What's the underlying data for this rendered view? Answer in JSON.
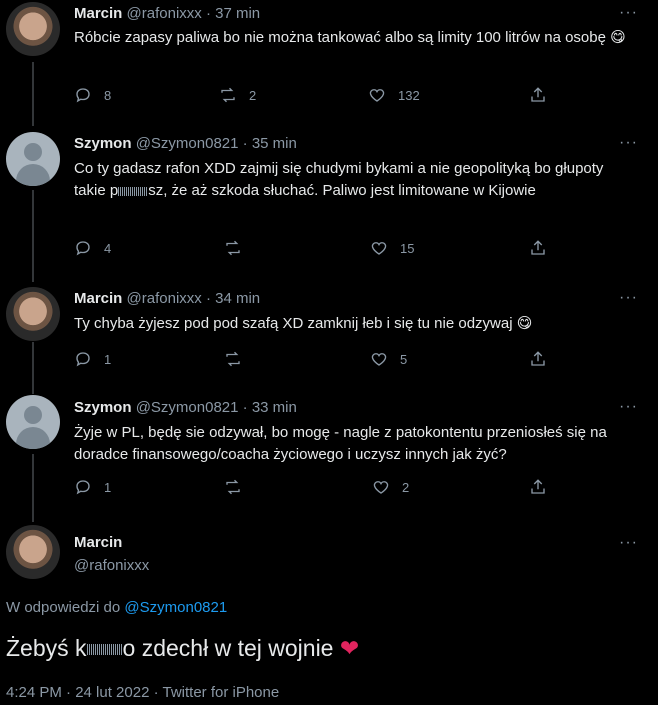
{
  "tweets": [
    {
      "name": "Marcin",
      "handle": "@rafonixxx",
      "dot": "·",
      "time": "37 min",
      "text": "Róbcie zapasy paliwa bo nie można tankować albo są limity 100 litrów na osobę",
      "emoji": "😋",
      "replies": "8",
      "retweets": "2",
      "likes": "132"
    },
    {
      "name": "Szymon",
      "handle": "@Szymon0821",
      "dot": "·",
      "time": "35 min",
      "text": "Co ty gadasz rafon XDD zajmij się chudymi bykami a nie geopolityką bo głupoty takie p",
      "text2": "sz, że aż szkoda słuchać. Paliwo jest limitowane w Kijowie",
      "replies": "4",
      "retweets": "",
      "likes": "15"
    },
    {
      "name": "Marcin",
      "handle": "@rafonixxx",
      "dot": "·",
      "time": "34 min",
      "text": "Ty chyba żyjesz pod pod szafą XD zamknij łeb i się tu nie odzywaj",
      "emoji": "😋",
      "replies": "1",
      "retweets": "",
      "likes": "5"
    },
    {
      "name": "Szymon",
      "handle": "@Szymon0821",
      "dot": "·",
      "time": "33 min",
      "text": "Żyje w PL, będę sie odzywał, bo mogę - nagle z patokontentu przeniosłeś się na doradce finansowego/coacha życiowego i uczysz innych jak żyć?",
      "replies": "1",
      "retweets": "",
      "likes": "2"
    }
  ],
  "main_tweet": {
    "name": "Marcin",
    "handle": "@rafonixxx",
    "replying_prefix": "W odpowiedzi do",
    "replying_to": "@Szymon0821",
    "text_start": "Żebyś k",
    "text_end": "o zdechł w tej wojnie",
    "heart": "❤",
    "meta": "4:24 PM · 24 lut 2022 · Twitter for iPhone"
  },
  "more_icon": "···"
}
